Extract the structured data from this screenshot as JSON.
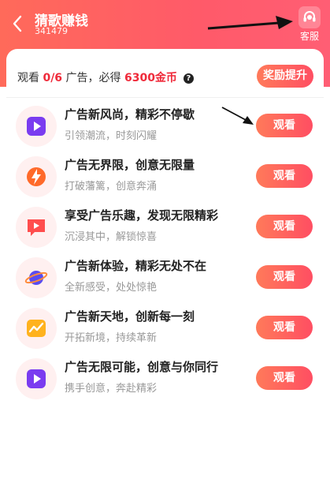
{
  "header": {
    "back_icon": "chevron-left-icon",
    "title": "猜歌赚钱",
    "subtitle": "341479",
    "service_label": "客服",
    "service_icon": "headset-icon"
  },
  "summary": {
    "prefix": "观看 ",
    "progress": "0/6",
    "middle": " 广告，必得 ",
    "reward": "6300金币",
    "help_icon": "question-icon",
    "boost_label": "奖励提升"
  },
  "tasks": [
    {
      "title": "广告新风尚，精彩不停歇",
      "subtitle": "引领潮流，时刻闪耀",
      "button": "观看",
      "icon": "play-icon",
      "color": "#7a3cf0"
    },
    {
      "title": "广告无界限，创意无限量",
      "subtitle": "打破藩篱，创意奔涌",
      "button": "观看",
      "icon": "lightning-icon",
      "color": "#ff6a2a"
    },
    {
      "title": "享受广告乐趣，发现无限精彩",
      "subtitle": "沉浸其中，解锁惊喜",
      "button": "观看",
      "icon": "video-message-icon",
      "color": "#ff4d4d"
    },
    {
      "title": "广告新体验，精彩无处不在",
      "subtitle": "全新感受，处处惊艳",
      "button": "观看",
      "icon": "planet-icon",
      "color": "#5a4cf0"
    },
    {
      "title": "广告新天地，创新每一刻",
      "subtitle": "开拓新境，持续革新",
      "button": "观看",
      "icon": "chart-icon",
      "color": "#ffb21e"
    },
    {
      "title": "广告无限可能，创意与你同行",
      "subtitle": "携手创意，奔赴精彩",
      "button": "观看",
      "icon": "play-icon",
      "color": "#7a3cf0"
    }
  ]
}
